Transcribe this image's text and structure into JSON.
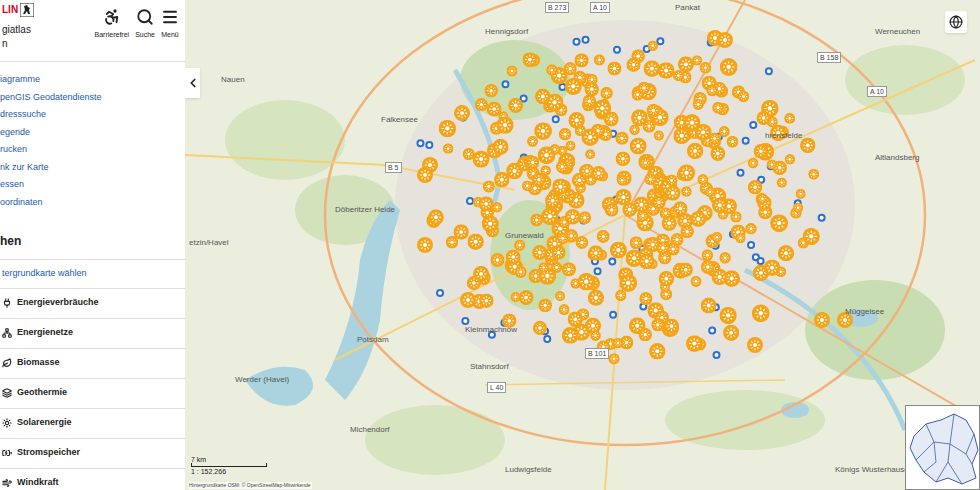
{
  "header": {
    "logo": "LIN",
    "title_lines": [
      "giatlas",
      "n"
    ],
    "tools": [
      {
        "label": "Barrierefrei"
      },
      {
        "label": "Suche"
      },
      {
        "label": "Menü"
      }
    ]
  },
  "links": [
    "iagramme",
    "penGIS Geodatendienste",
    "dresssuche",
    "egende",
    "rucken",
    "nk zur Karte",
    "essen",
    "oordinaten"
  ],
  "themes": {
    "title": "hen",
    "basemap_link": "tergrundkarte wählen",
    "items": [
      "Energieverbräuche",
      "Energienetze",
      "Biomasse",
      "Geothermie",
      "Solarenergie",
      "Stromspeicher",
      "Windkraft"
    ]
  },
  "map": {
    "places": [
      {
        "name": "Hennigsdorf"
      },
      {
        "name": "Pankat"
      },
      {
        "name": "Werneuchen"
      },
      {
        "name": "Nauen"
      },
      {
        "name": "Falkensee"
      },
      {
        "name": "hrensfelde"
      },
      {
        "name": "Altlandsberg"
      },
      {
        "name": "Döberitzer Heide"
      },
      {
        "name": "etzin/Havel"
      },
      {
        "name": "Grunewald"
      },
      {
        "name": "Potsdam"
      },
      {
        "name": "Kleinmachnow"
      },
      {
        "name": "Stahnsdorf"
      },
      {
        "name": "Werder (Havel)"
      },
      {
        "name": "Michendorf"
      },
      {
        "name": "Ludwigsfelde"
      },
      {
        "name": "Königs Wusterhausen"
      },
      {
        "name": "Müggelsee"
      }
    ],
    "roads": [
      {
        "label": "B 273"
      },
      {
        "label": "A 10"
      },
      {
        "label": "B 158"
      },
      {
        "label": "A 10"
      },
      {
        "label": "B 5"
      },
      {
        "label": "B 101"
      },
      {
        "label": "L 40"
      }
    ],
    "scale": {
      "label": "7 km",
      "ratio": "1 : 152.266"
    },
    "attribution": "Hintergrundkarte OSM: © OpenStreetMap-Mitwirkende"
  }
}
